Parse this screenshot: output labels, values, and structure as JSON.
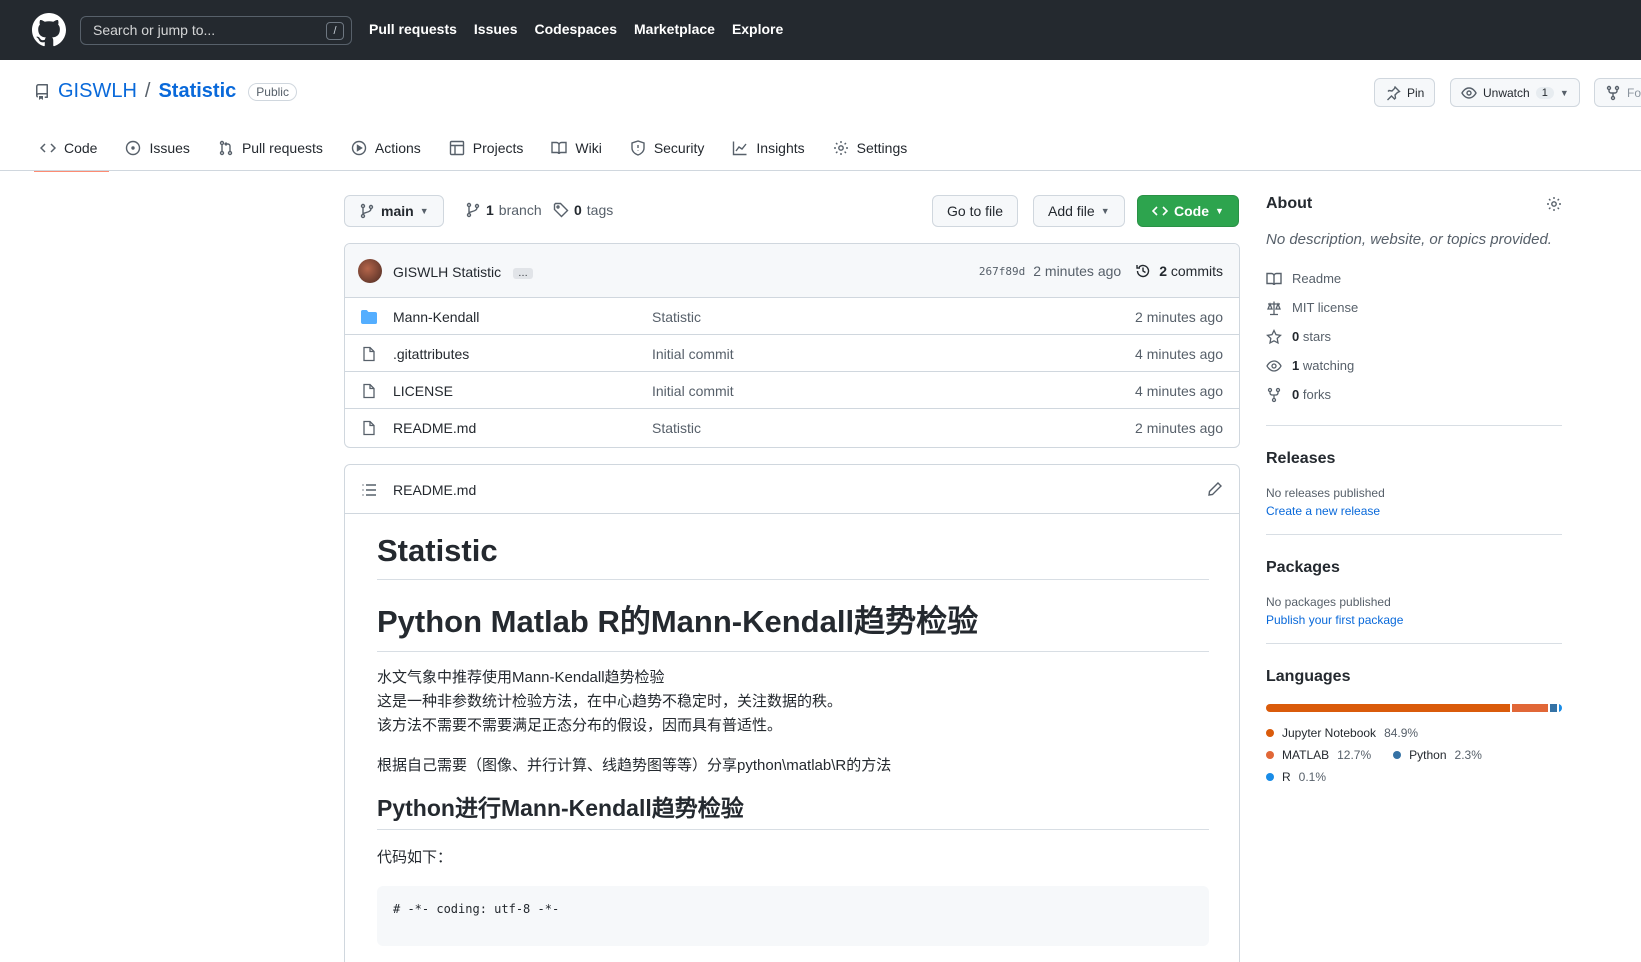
{
  "header": {
    "search_placeholder": "Search or jump to...",
    "search_shortcut": "/",
    "nav": [
      "Pull requests",
      "Issues",
      "Codespaces",
      "Marketplace",
      "Explore"
    ]
  },
  "repo": {
    "owner": "GISWLH",
    "separator": "/",
    "name": "Statistic",
    "visibility": "Public",
    "pin_label": "Pin",
    "unwatch_label": "Unwatch",
    "watch_count": "1",
    "fork_label": "Fo"
  },
  "tabs": [
    {
      "label": "Code",
      "icon": "code-icon",
      "active": true
    },
    {
      "label": "Issues",
      "icon": "issue-opened-icon"
    },
    {
      "label": "Pull requests",
      "icon": "git-pull-request-icon"
    },
    {
      "label": "Actions",
      "icon": "play-icon"
    },
    {
      "label": "Projects",
      "icon": "table-icon"
    },
    {
      "label": "Wiki",
      "icon": "book-icon"
    },
    {
      "label": "Security",
      "icon": "shield-icon"
    },
    {
      "label": "Insights",
      "icon": "graph-icon"
    },
    {
      "label": "Settings",
      "icon": "gear-icon"
    }
  ],
  "toolbar": {
    "branch": "main",
    "branches_count": "1",
    "branches_label": "branch",
    "tags_count": "0",
    "tags_label": "tags",
    "go_to_file": "Go to file",
    "add_file": "Add file",
    "code": "Code"
  },
  "commit": {
    "author": "GISWLH",
    "message": "Statistic",
    "ellipsis": "…",
    "sha": "267f89d",
    "age": "2 minutes ago",
    "commits_count": "2",
    "commits_label": "commits"
  },
  "files": [
    {
      "name": "Mann-Kendall",
      "type": "dir",
      "message": "Statistic",
      "age": "2 minutes ago"
    },
    {
      "name": ".gitattributes",
      "type": "file",
      "message": "Initial commit",
      "age": "4 minutes ago"
    },
    {
      "name": "LICENSE",
      "type": "file",
      "message": "Initial commit",
      "age": "4 minutes ago"
    },
    {
      "name": "README.md",
      "type": "file",
      "message": "Statistic",
      "age": "2 minutes ago"
    }
  ],
  "readme": {
    "filename": "README.md",
    "h1": "Statistic",
    "h2": "Python Matlab R的Mann-Kendall趋势检验",
    "p1_lines": [
      "水文气象中推荐使用Mann-Kendall趋势检验",
      "这是一种非参数统计检验方法，在中心趋势不稳定时，关注数据的秩。",
      "该方法不需要不需要满足正态分布的假设，因而具有普适性。"
    ],
    "p2": "根据自己需要（图像、并行计算、线趋势图等等）分享python\\matlab\\R的方法",
    "h3": "Python进行Mann-Kendall趋势检验",
    "p3": "代码如下：",
    "code": "# -*- coding: utf-8 -*-"
  },
  "about": {
    "title": "About",
    "description": "No description, website, or topics provided.",
    "readme": "Readme",
    "license": "MIT license",
    "stars_count": "0",
    "stars_label": "stars",
    "watching_count": "1",
    "watching_label": "watching",
    "forks_count": "0",
    "forks_label": "forks"
  },
  "releases": {
    "title": "Releases",
    "none": "No releases published",
    "link": "Create a new release"
  },
  "packages": {
    "title": "Packages",
    "none": "No packages published",
    "link": "Publish your first package"
  },
  "languages": {
    "title": "Languages",
    "items": [
      {
        "name": "Jupyter Notebook",
        "percent": "84.9%",
        "value": 84.9,
        "color": "#DA5B0B"
      },
      {
        "name": "MATLAB",
        "percent": "12.7%",
        "value": 12.7,
        "color": "#e16737"
      },
      {
        "name": "Python",
        "percent": "2.3%",
        "value": 2.3,
        "color": "#3572A5"
      },
      {
        "name": "R",
        "percent": "0.1%",
        "value": 0.1,
        "color": "#198CE7"
      }
    ]
  }
}
